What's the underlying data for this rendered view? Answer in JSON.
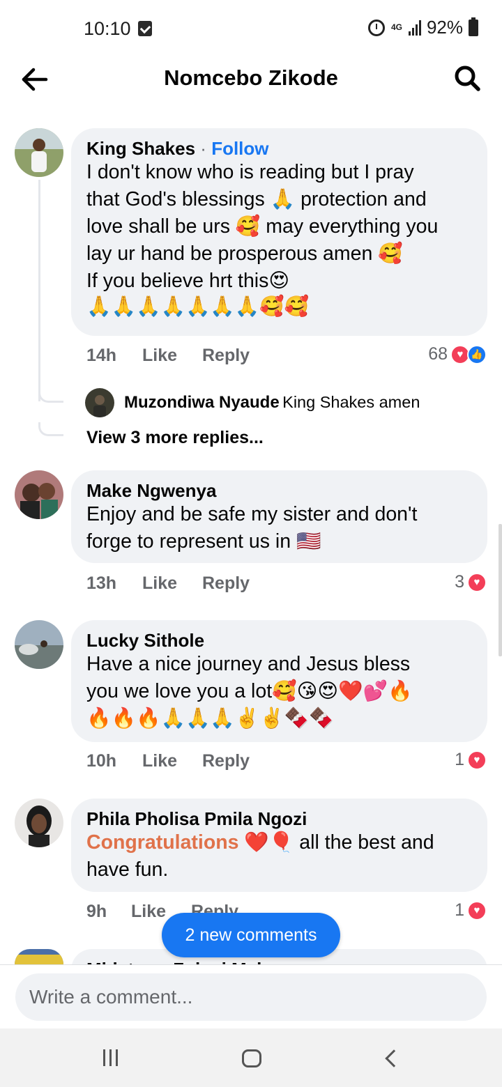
{
  "status_bar": {
    "time": "10:10",
    "network": "4G",
    "battery": "92%"
  },
  "header": {
    "title": "Nomcebo Zikode"
  },
  "comments": [
    {
      "author": "King Shakes",
      "follow_label": "Follow",
      "lines": [
        "I don't know who is reading but I pray",
        "that God's blessings 🙏 protection and",
        "love shall be urs 🥰 may everything you",
        "lay ur hand be prosperous amen 🥰",
        "If you believe hrt this😍",
        "🙏🙏🙏🙏🙏🙏🙏🥰🥰"
      ],
      "time": "14h",
      "like_label": "Like",
      "reply_label": "Reply",
      "reaction_count": "68"
    },
    {
      "author": "Make Ngwenya",
      "lines": [
        "Enjoy and be safe my sister and don't",
        "forge to represent us in 🇺🇸"
      ],
      "time": "13h",
      "like_label": "Like",
      "reply_label": "Reply",
      "reaction_count": "3"
    },
    {
      "author": "Lucky Sithole",
      "lines": [
        "Have a nice journey and Jesus bless",
        "you we love you a lot🥰😘😍❤️💕🔥",
        "🔥🔥🔥🙏🙏🙏✌️✌️🍫🍫"
      ],
      "time": "10h",
      "like_label": "Like",
      "reply_label": "Reply",
      "reaction_count": "1"
    },
    {
      "author": "Phila Pholisa Pmila Ngozi",
      "highlight": "Congratulations",
      "line1_rest": " ❤️🎈 all the best and",
      "line2": "have fun.",
      "time": "9h",
      "like_label": "Like",
      "reply_label": "Reply",
      "reaction_count": "1"
    }
  ],
  "reply": {
    "author": "Muzondiwa Nyaude",
    "text": "King Shakes amen"
  },
  "view_more": "View 3 more replies...",
  "new_comments_label": "2 new comments",
  "compose": {
    "placeholder": "Write a comment..."
  },
  "partial_author": "Mhlatywa Zolani Makosa"
}
